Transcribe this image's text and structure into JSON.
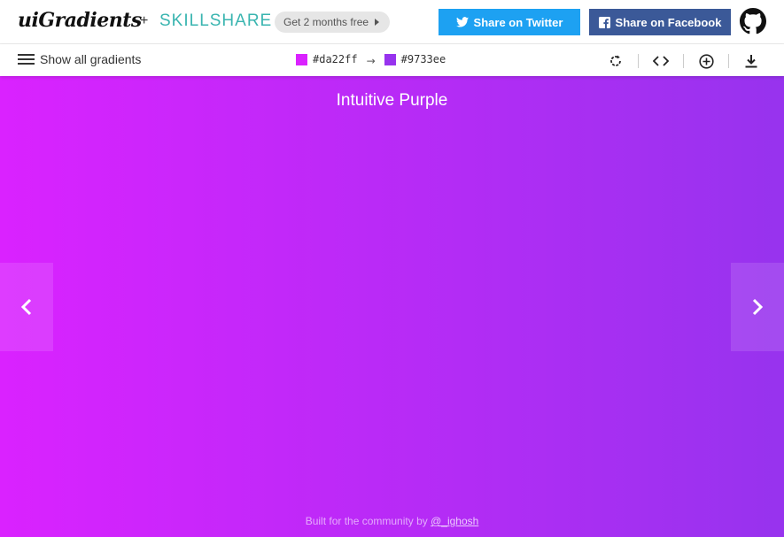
{
  "header": {
    "logo": "uiGradients",
    "plus": "+",
    "partner": "SKILLSHARE",
    "promo": "Get 2 months free",
    "twitter_label": "Share on Twitter",
    "facebook_label": "Share on Facebook"
  },
  "toolbar": {
    "menu_label": "Show all gradients",
    "color_from": "#da22ff",
    "color_to": "#9733ee",
    "arrow": "→",
    "tools": [
      "rotate-icon",
      "code-icon",
      "add-icon",
      "download-icon"
    ]
  },
  "gradient": {
    "name": "Intuitive Purple",
    "from": "#da22ff",
    "to": "#9733ee"
  },
  "footer": {
    "text": "Built for the community by",
    "author": "@_ighosh"
  }
}
